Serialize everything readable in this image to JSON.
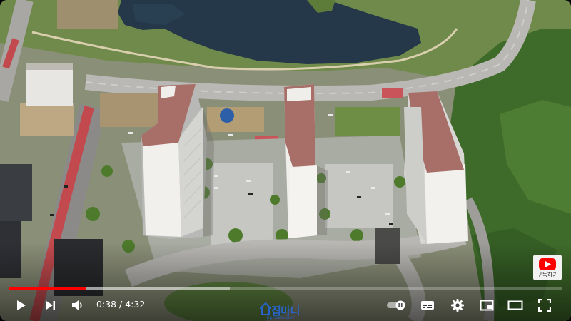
{
  "player": {
    "time_display": "0:38 / 4:32",
    "progress_played_fraction": 0.14,
    "progress_loaded_fraction": 0.4,
    "autoplay_on": true
  },
  "channel": {
    "subscribe_label": "구독하기",
    "watermark_text": "집마니",
    "watermark_url": "jipmani.com"
  },
  "icons": {
    "play": "play-icon",
    "next": "next-icon",
    "volume": "volume-icon",
    "autoplay": "autoplay-toggle-icon",
    "subtitles": "subtitles-icon",
    "settings": "gear-icon",
    "miniplayer": "miniplayer-icon",
    "theater": "theater-mode-icon",
    "fullscreen": "fullscreen-icon"
  },
  "colors": {
    "progress_red": "#ff0000",
    "subscribe_red": "#ff0000",
    "watermark_blue": "#2a63c8"
  }
}
